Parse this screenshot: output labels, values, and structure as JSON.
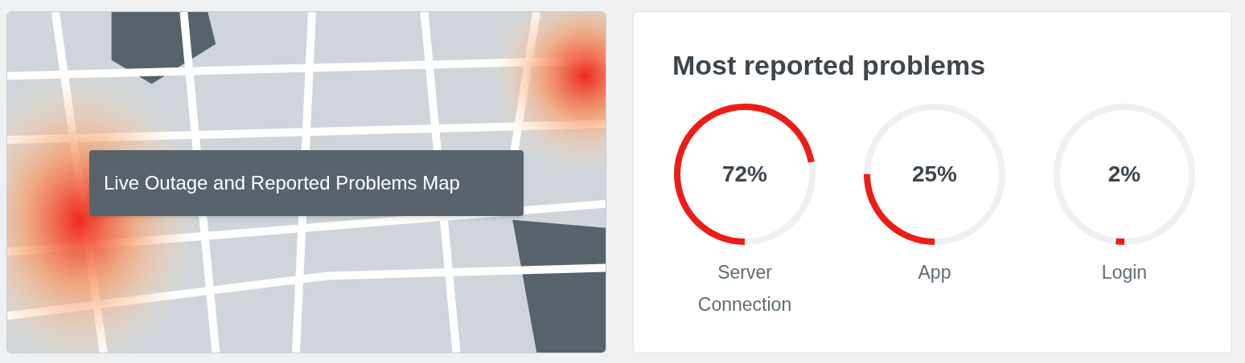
{
  "map": {
    "kind": "picture",
    "label": "Live Outage and Reported Problems Map"
  },
  "panel": {
    "title": "Most reported problems"
  },
  "problems": [
    {
      "percent": "72%",
      "level": 0.72,
      "label": "Server Connection"
    },
    {
      "percent": "25%",
      "level": 0.25,
      "label": "App"
    },
    {
      "percent": "2%",
      "level": 0.02,
      "label": "Login"
    }
  ]
}
